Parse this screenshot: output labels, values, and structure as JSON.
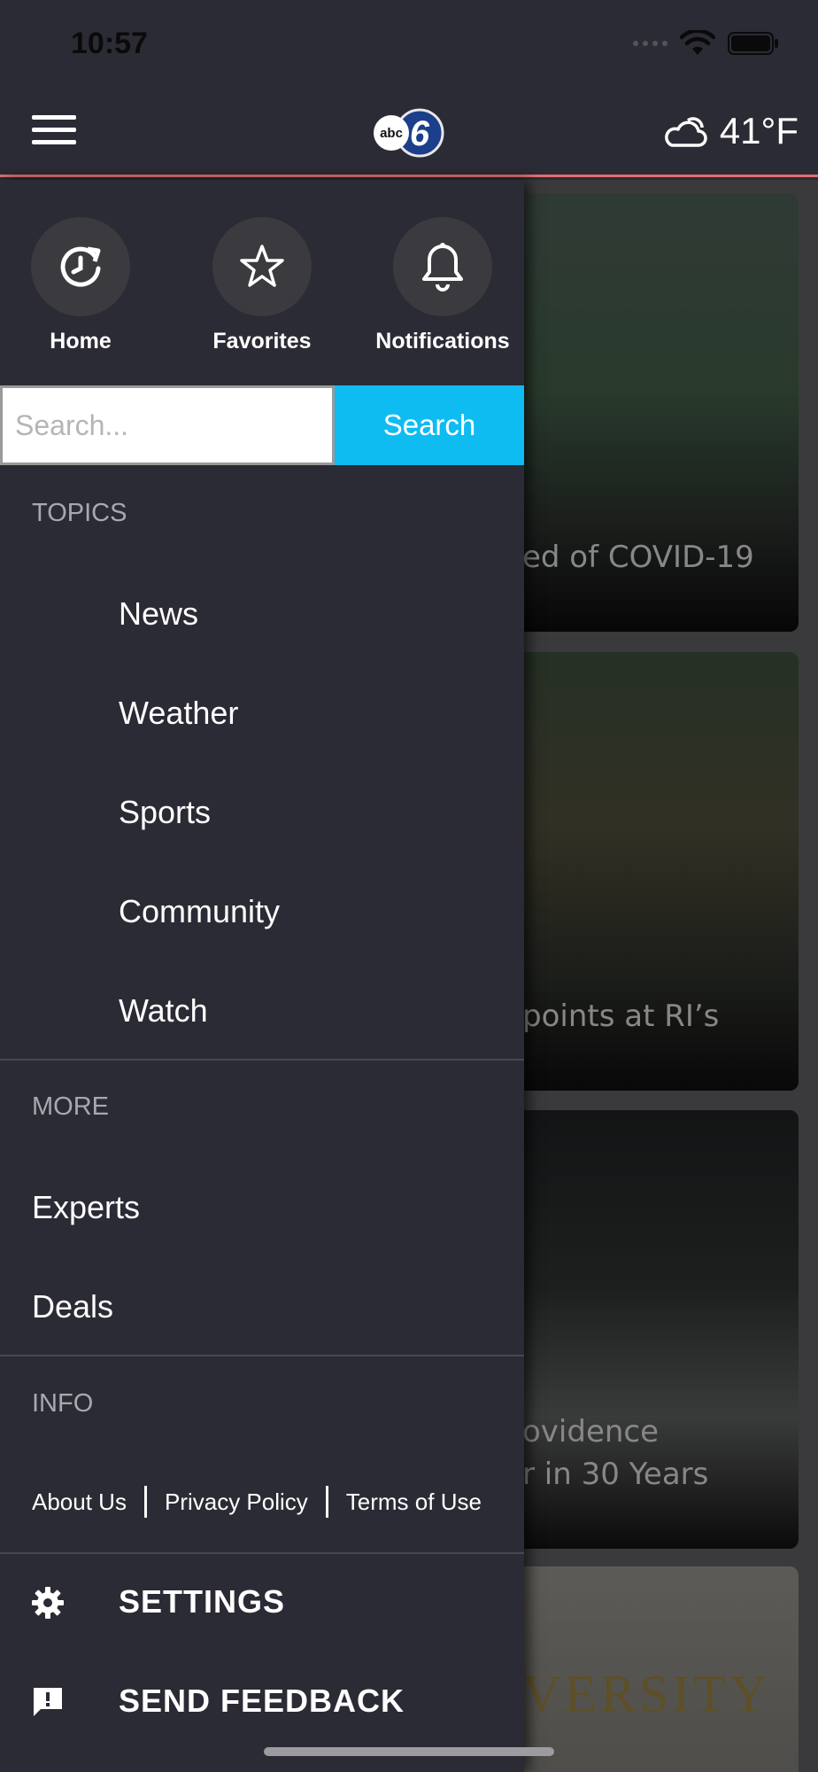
{
  "status_bar": {
    "time": "10:57"
  },
  "header": {
    "logo_text": "abc6",
    "temperature": "41°F",
    "weather_icon": "partly-cloudy-icon",
    "menu_icon": "hamburger-menu-icon"
  },
  "drawer": {
    "quick_actions": [
      {
        "label": "Home",
        "icon": "home-refresh-icon"
      },
      {
        "label": "Favorites",
        "icon": "star-icon"
      },
      {
        "label": "Notifications",
        "icon": "bell-icon"
      }
    ],
    "search": {
      "placeholder": "Search...",
      "button_label": "Search"
    },
    "topics_label": "TOPICS",
    "topics": [
      "News",
      "Weather",
      "Sports",
      "Community",
      "Watch"
    ],
    "more_label": "MORE",
    "more_items": [
      "Experts",
      "Deals"
    ],
    "info_label": "INFO",
    "info_links": [
      "About Us",
      "Privacy Policy",
      "Terms of Use"
    ],
    "settings_label": "SETTINGS",
    "feedback_label": "SEND FEEDBACK"
  },
  "background_cards": [
    {
      "headline": "ed of COVID-19"
    },
    {
      "headline": "points at RI’s"
    },
    {
      "headline_line1": "ovidence",
      "headline_line2": "r in 30 Years"
    },
    {
      "headline": "VERSITY"
    }
  ],
  "colors": {
    "background": "#2b2b35",
    "accent_search": "#0ebcf2",
    "header_border": "#e07070"
  }
}
